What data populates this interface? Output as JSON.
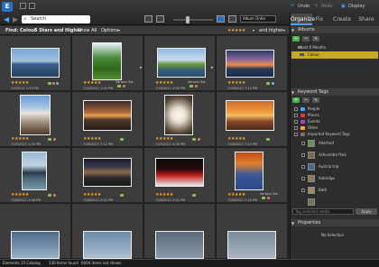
{
  "window": {
    "title": "Elements Organizer"
  },
  "topbar": {
    "undo": "Undo",
    "redo": "Redo",
    "display": "Display",
    "search_placeholder": "Search",
    "sort_option": "Album Order"
  },
  "tabs": [
    "Organize",
    "Fix",
    "Create",
    "Share"
  ],
  "filter": {
    "find_label": "Find: Colour",
    "criteria": "5 Stars and Higher",
    "show_all": "Show All",
    "options": "Options",
    "and_higher": "and higher"
  },
  "albums": {
    "header": "Albums",
    "items": [
      "Last 6 Months",
      "Colour"
    ]
  },
  "keyword_tags": {
    "header": "Keyword Tags",
    "categories": [
      "People",
      "Places",
      "Events",
      "Other",
      "Imported Keyword Tags"
    ],
    "tags": [
      "Allerford",
      "Ashcombe Park",
      "Austria trip",
      "Axbridge",
      "Bath"
    ],
    "input_placeholder": "Tag selected media",
    "apply": "Apply"
  },
  "properties": {
    "header": "Properties",
    "text": "No Selection"
  },
  "photos": [
    {
      "date": "7/5/2011 1:33 PM",
      "caption": ""
    },
    {
      "date": "7/25/2011 1:22 PM",
      "caption": "Version Set"
    },
    {
      "date": "7/18/2011 4:30 PM",
      "caption": "Version Set"
    },
    {
      "date": "7/26/2011 7:12 PM",
      "caption": ""
    },
    {
      "date": "7/25/2011 1:32 PM",
      "caption": ""
    },
    {
      "date": "7/26/2011 7:12 PM",
      "caption": ""
    },
    {
      "date": "7/25/2011 4:30 PM",
      "caption": ""
    },
    {
      "date": "7/26/2011 7:13 PM",
      "caption": ""
    },
    {
      "date": "7/26/2011 1:46 PM",
      "caption": ""
    },
    {
      "date": "7/26/2011 3:51 PM",
      "caption": ""
    },
    {
      "date": "7/26/2011 3:51 PM",
      "caption": ""
    },
    {
      "date": "7/26/2011 7:16 PM",
      "caption": "Version Set"
    }
  ],
  "status": {
    "elements": "Elements 15 Catalog",
    "count": "130 Items found",
    "notes": "6904 items not shown"
  }
}
